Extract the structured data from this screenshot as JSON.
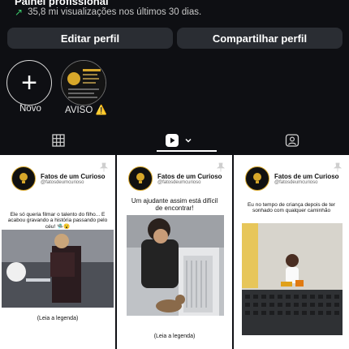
{
  "header": {
    "title_partial": "Painel profissional",
    "views_text": "35,8 mi visualizações nos últimos 30 dias."
  },
  "buttons": {
    "edit": "Editar perfil",
    "share": "Compartilhar perfil"
  },
  "highlights": [
    {
      "label": "Novo",
      "icon": "plus-icon"
    },
    {
      "label": "AVISO ⚠️",
      "icon": "aviso-highlight"
    }
  ],
  "tabs": [
    {
      "name": "grid",
      "icon": "grid-icon"
    },
    {
      "name": "reels",
      "icon": "reels-icon",
      "active": true
    },
    {
      "name": "tagged",
      "icon": "tagged-icon"
    }
  ],
  "posts": [
    {
      "account": "Fatos de um Curioso",
      "handle": "@fatosdeumcurioso",
      "caption": "Ele só queria filmar o talento do filho... E acabou gravando a história passando pelo céu! 🛸😮",
      "footer": "(Leia a legenda)"
    },
    {
      "account": "Fatos de um Curioso",
      "handle": "@fatosdeumcurioso",
      "caption": "Um ajudante assim está difícil de encontrar!",
      "footer": "(Leia a legenda)"
    },
    {
      "account": "Fatos de um Curioso",
      "handle": "@fatosdeumcurioso",
      "caption": "Eu no tempo de criança depois de ter sonhado com qualquer caminhão"
    }
  ],
  "colors": {
    "background": "#0e0f13",
    "button": "#2a2d33",
    "trend_green": "#3ccf6e",
    "logo_gold": "#d7a72a"
  }
}
